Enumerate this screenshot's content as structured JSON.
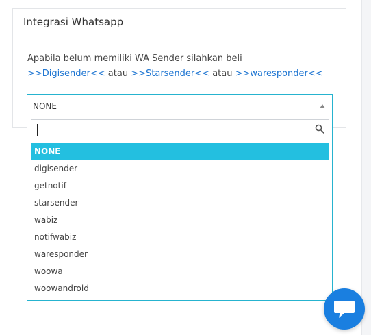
{
  "card": {
    "title": "Integrasi Whatsapp",
    "description": "Apabila belum memiliki WA Sender silahkan beli",
    "links": [
      ">>Digisender<<",
      ">>Starsender<<",
      ">>waresponder<<"
    ],
    "separator": " atau "
  },
  "select": {
    "selected_value": "NONE",
    "search_value": "",
    "options": [
      "NONE",
      "digisender",
      "getnotif",
      "starsender",
      "wabiz",
      "notifwabiz",
      "waresponder",
      "woowa",
      "woowandroid"
    ]
  },
  "colors": {
    "accent": "#26b3cf",
    "selected_bg": "#23bfe0",
    "link": "#1f76d2",
    "chat_button": "#1a7fe0"
  },
  "icons": {
    "search": "search-icon",
    "caret": "caret-up-icon",
    "chat": "chat-icon"
  }
}
